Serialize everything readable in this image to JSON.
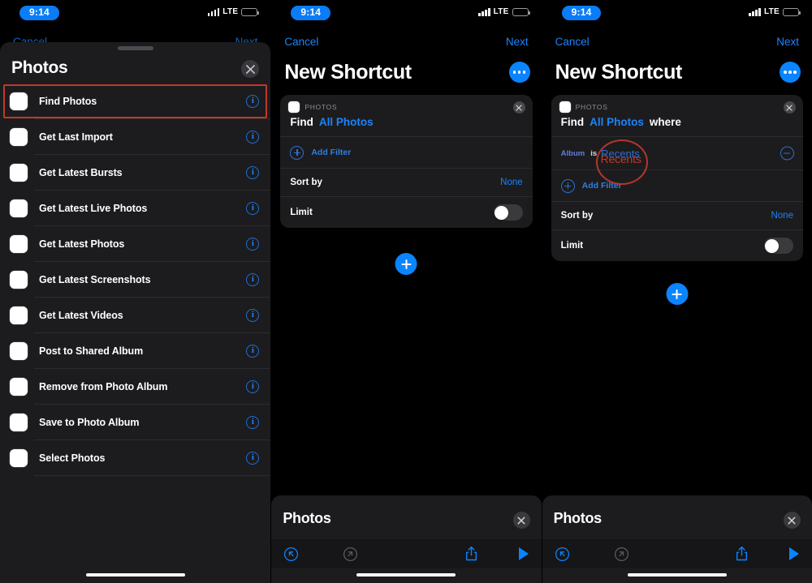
{
  "status_bar": {
    "time": "9:14",
    "carrier_tech": "LTE",
    "signal_icon": "cellular-bars-icon",
    "battery_icon": "battery-icon",
    "battery_level_percent": 52
  },
  "colors": {
    "accent_blue": "#0a84ff",
    "link_blue": "#1b84fb",
    "annotation_red": "#c0392b",
    "card_bg": "#1c1c1e",
    "screen_bg": "#000000",
    "separator": "#2c2c2e"
  },
  "panel1": {
    "nav": {
      "cancel": "Cancel",
      "next": "Next"
    },
    "sheet": {
      "title": "Photos",
      "close_icon": "close-icon",
      "grabber": "sheet-grabber"
    },
    "actions": [
      {
        "label": "Find Photos",
        "icon": "photos-app-icon",
        "info_icon": "info-icon",
        "highlighted": true
      },
      {
        "label": "Get Last Import",
        "icon": "photos-app-icon",
        "info_icon": "info-icon",
        "highlighted": false
      },
      {
        "label": "Get Latest Bursts",
        "icon": "photos-app-icon",
        "info_icon": "info-icon",
        "highlighted": false
      },
      {
        "label": "Get Latest Live Photos",
        "icon": "photos-app-icon",
        "info_icon": "info-icon",
        "highlighted": false
      },
      {
        "label": "Get Latest Photos",
        "icon": "photos-app-icon",
        "info_icon": "info-icon",
        "highlighted": false
      },
      {
        "label": "Get Latest Screenshots",
        "icon": "photos-app-icon",
        "info_icon": "info-icon",
        "highlighted": false
      },
      {
        "label": "Get Latest Videos",
        "icon": "photos-app-icon",
        "info_icon": "info-icon",
        "highlighted": false
      },
      {
        "label": "Post to Shared Album",
        "icon": "photos-app-icon",
        "info_icon": "info-icon",
        "highlighted": false
      },
      {
        "label": "Remove from Photo Album",
        "icon": "photos-app-icon",
        "info_icon": "info-icon",
        "highlighted": false
      },
      {
        "label": "Save to Photo Album",
        "icon": "photos-app-icon",
        "info_icon": "info-icon",
        "highlighted": false
      },
      {
        "label": "Select Photos",
        "icon": "photos-app-icon",
        "info_icon": "info-icon",
        "highlighted": false
      }
    ]
  },
  "panel2": {
    "nav": {
      "cancel": "Cancel",
      "next": "Next"
    },
    "title": "New Shortcut",
    "more_icon": "more-ellipsis-icon",
    "card": {
      "app_name": "PHOTOS",
      "app_icon": "photos-app-icon",
      "close_icon": "close-icon",
      "find_word": "Find",
      "find_value": "All Photos",
      "add_filter_label": "Add Filter",
      "sort_by_label": "Sort by",
      "sort_by_value": "None",
      "limit_label": "Limit",
      "limit_on": false
    },
    "add_action_icon": "plus-icon",
    "bottom_sheet": {
      "title": "Photos",
      "close_icon": "close-icon",
      "undo_icon": "undo-icon",
      "redo_icon": "redo-icon",
      "share_icon": "share-icon",
      "run_icon": "play-icon"
    }
  },
  "panel3": {
    "nav": {
      "cancel": "Cancel",
      "next": "Next"
    },
    "title": "New Shortcut",
    "more_icon": "more-ellipsis-icon",
    "card": {
      "app_name": "PHOTOS",
      "app_icon": "photos-app-icon",
      "close_icon": "close-icon",
      "find_word": "Find",
      "find_value": "All Photos",
      "where_word": "where",
      "filter": {
        "key": "Album",
        "operator": "is",
        "value": "Recents",
        "remove_icon": "minus-icon"
      },
      "add_filter_label": "Add Filter",
      "sort_by_label": "Sort by",
      "sort_by_value": "None",
      "limit_label": "Limit",
      "limit_on": false
    },
    "add_action_icon": "plus-icon",
    "bottom_sheet": {
      "title": "Photos",
      "close_icon": "close-icon",
      "undo_icon": "undo-icon",
      "redo_icon": "redo-icon",
      "share_icon": "share-icon",
      "run_icon": "play-icon"
    }
  }
}
